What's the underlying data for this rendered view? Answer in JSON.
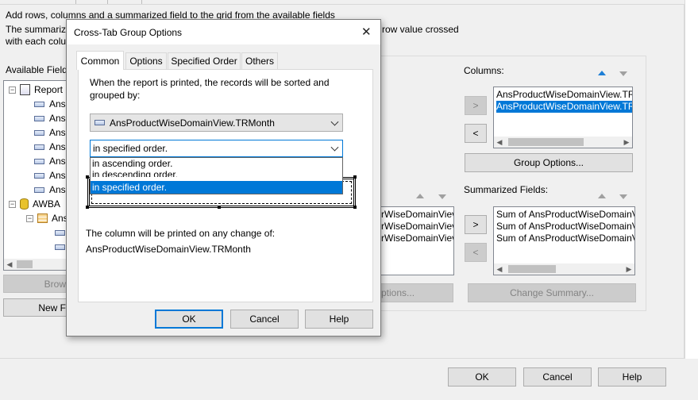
{
  "background": {
    "intro_line1": "Add rows, columns and a summarized field to the grid from the available fields",
    "intro_line2_left": "The summariz",
    "intro_line2_right": "row value crossed",
    "intro_line3": "with each colu",
    "available_fields_label": "Available Field",
    "tree": [
      {
        "label": "Report",
        "indent": 0,
        "type": "report",
        "expander": "minus"
      },
      {
        "label": "Ans",
        "indent": 1,
        "type": "field"
      },
      {
        "label": "Ans",
        "indent": 1,
        "type": "field"
      },
      {
        "label": "Ans",
        "indent": 1,
        "type": "field"
      },
      {
        "label": "Ans",
        "indent": 1,
        "type": "field"
      },
      {
        "label": "Ans",
        "indent": 1,
        "type": "field"
      },
      {
        "label": "Ans",
        "indent": 1,
        "type": "field"
      },
      {
        "label": "Ans",
        "indent": 1,
        "type": "field"
      },
      {
        "label": "AWBA",
        "indent": 0,
        "type": "db",
        "expander": "minus"
      },
      {
        "label": "Ans",
        "indent": 1,
        "type": "table",
        "expander": "minus"
      },
      {
        "label": "",
        "indent": 2,
        "type": "field"
      },
      {
        "label": "",
        "indent": 2,
        "type": "field"
      }
    ],
    "browse_label": "Brow",
    "new_label": "New F",
    "columns_label": "Columns:",
    "columns_items": [
      "AnsProductWiseDomainView.TR",
      "AnsProductWiseDomainView.TR"
    ],
    "columns_selected_index": 1,
    "add_arrow": ">",
    "remove_arrow": "<",
    "group_options_label": "Group Options...",
    "summarized_label": "Summarized Fields:",
    "summarized_items": [
      "Sum of AnsProductWiseDomainV",
      "Sum of AnsProductWiseDomainV",
      "Sum of AnsProductWiseDomainV"
    ],
    "rows_items": [
      "rWiseDomainViev",
      "rWiseDomainViev",
      "rWiseDomainViev"
    ],
    "rows_options_label": "ptions...",
    "change_summary_label": "Change Summary...",
    "ok_label": "OK",
    "cancel_label": "Cancel",
    "help_label": "Help"
  },
  "dialog": {
    "title": "Cross-Tab Group Options",
    "close_glyph": "✕",
    "tabs": [
      "Common",
      "Options",
      "Specified Order",
      "Others"
    ],
    "active_tab": 0,
    "sort_instruction_line1": "When the report is printed, the records will be sorted and",
    "sort_instruction_line2": "grouped by:",
    "group_field": "AnsProductWiseDomainView.TRMonth",
    "sort_order_value": "in specified order.",
    "sort_order_options": [
      "in ascending order.",
      "in descending order.",
      "in specified order."
    ],
    "sort_order_selected_index": 2,
    "print_change_label": "The column will be printed on any change of:",
    "print_change_value": "AnsProductWiseDomainView.TRMonth",
    "ok_label": "OK",
    "cancel_label": "Cancel",
    "help_label": "Help"
  },
  "colors": {
    "accent": "#0078d7",
    "window_bg": "#f0f0f0"
  }
}
